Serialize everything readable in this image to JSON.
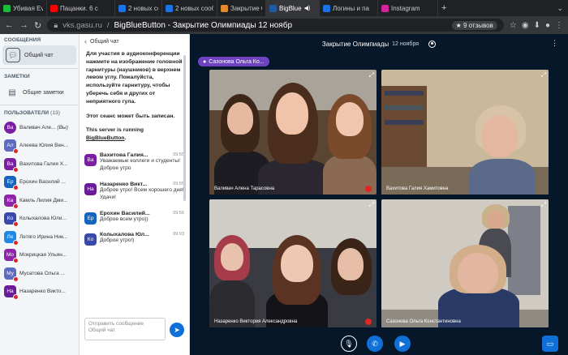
{
  "tabs": [
    {
      "label": "Убивая Ev",
      "color": "#1dbb3c",
      "badge": ""
    },
    {
      "label": "Пацанки. 6 с",
      "color": "#ff0000",
      "badge": ""
    },
    {
      "label": "2 новых сооб",
      "color": "#1a73e8",
      "badge": ""
    },
    {
      "label": "2 новых сооб",
      "color": "#1a73e8",
      "badge": ""
    },
    {
      "label": "Закрытие О",
      "color": "#e38b2c",
      "badge": ""
    },
    {
      "label": "BigBlue",
      "color": "#1f5aa6",
      "badge": "4",
      "active": true
    },
    {
      "label": "Логины и па",
      "color": "#1a73e8",
      "badge": ""
    },
    {
      "label": "Instagram",
      "color": "#d6249f",
      "badge": ""
    }
  ],
  "url": {
    "host": "vks.gasu.ru",
    "separator": "/",
    "title": "BigBlueButton - Закрытие Олимпиады 12 ноябр",
    "reviews": "9 отзывов"
  },
  "sidebar": {
    "messages_title": "СООБЩЕНИЯ",
    "public_chat": "Общий чат",
    "notes_title": "ЗАМЕТКИ",
    "shared_notes": "Общие заметки",
    "users_title": "ПОЛЬЗОВАТЕЛИ",
    "users_count": "(13)",
    "users": [
      {
        "initials": "Ва",
        "name": "Валивач Але...",
        "suffix": "(Вы)",
        "color": "#7b1fa2",
        "mod": true
      },
      {
        "initials": "Ал",
        "name": "Алеева Юлия Вен...",
        "suffix": "",
        "color": "#5c6bc0",
        "mod": false
      },
      {
        "initials": "Ва",
        "name": "Вахитова Галия Х...",
        "suffix": "",
        "color": "#7b1fa2",
        "mod": false
      },
      {
        "initials": "Ер",
        "name": "Ерохин Василий ...",
        "suffix": "",
        "color": "#1565c0",
        "mod": false
      },
      {
        "initials": "Ка",
        "name": "Камль Лилия Дми...",
        "suffix": "",
        "color": "#8e24aa",
        "mod": false
      },
      {
        "initials": "Ко",
        "name": "Колыхалова Юли...",
        "suffix": "",
        "color": "#3949ab",
        "mod": false
      },
      {
        "initials": "Ле",
        "name": "Летяго Ирина Ник...",
        "suffix": "",
        "color": "#1e88e5",
        "mod": false
      },
      {
        "initials": "Мо",
        "name": "Мокрицкая Ульян...",
        "suffix": "",
        "color": "#8e24aa",
        "mod": false
      },
      {
        "initials": "Му",
        "name": "Мусатова Ольга ...",
        "suffix": "",
        "color": "#5c6bc0",
        "mod": false
      },
      {
        "initials": "На",
        "name": "Назаренко Викто...",
        "suffix": "",
        "color": "#6a1b9a",
        "mod": false
      }
    ]
  },
  "chat": {
    "title": "Общий чат",
    "welcome_1": "Для участия в аудиоконференции нажмите на изображение головной гарнитуры (наушников) в верхнем левом углу. Пожалуйста, используйте гарнитуру, чтобы уберечь себя и других от неприятного гула.",
    "welcome_2": "Этот сеанс может быть записан.",
    "welcome_3": "This server is running",
    "welcome_link": "BigBlueButton",
    "welcome_dot": ".",
    "messages": [
      {
        "initials": "Ва",
        "name": "Вахитова Галия...",
        "time": "09:55",
        "text": "Уважаемые коллеги и студенты! Доброе утро",
        "color": "#7b1fa2"
      },
      {
        "initials": "На",
        "name": "Назаренко Викт...",
        "time": "09:55",
        "text": "Доброе утро! Всем хорошего дня! Удачи!",
        "color": "#6a1b9a"
      },
      {
        "initials": "Ер",
        "name": "Ерохин Василий...",
        "time": "09:56",
        "text": "Доброе всем утро))",
        "color": "#1565c0"
      },
      {
        "initials": "Ко",
        "name": "Колыхалова Юл...",
        "time": "09:03",
        "text": "Доброе утро!)",
        "color": "#3949ab"
      }
    ],
    "input_placeholder": "Отправить сообщение Общий чат"
  },
  "main": {
    "title": "Закрытие Олимпиады",
    "date": "12 ноября",
    "talker": "Сазонова Ольга Ко...",
    "tiles": [
      {
        "label": "Валивач Алена Тарасовна"
      },
      {
        "label": "Вахитова Галия Хамитовна"
      },
      {
        "label": "Назаренко Виктория Александровна"
      },
      {
        "label": "Сазонова Ольга Константиновна"
      }
    ]
  }
}
